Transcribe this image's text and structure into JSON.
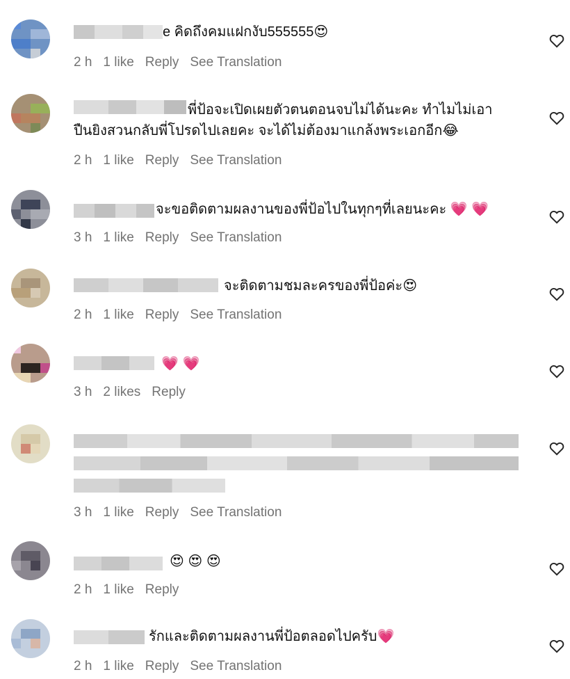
{
  "colors": {
    "meta": "#737373",
    "text": "#111111",
    "heart_red": "#e0245e"
  },
  "comments": [
    {
      "text": "e คิดถึงคมแฝกงับ555555",
      "emoji": "😍",
      "time": "2 h",
      "likes": "1 like",
      "reply": "Reply",
      "translate": "See Translation"
    },
    {
      "text": "พี่ป้อจะเปิดเผยตัวตนตอนจบไม่ได้นะคะ ทำไมไม่เอา",
      "text2": "ปืนยิงสวนกลับพี่โปรดไปเลยคะ จะได้ไม่ต้องมาแกล้งพระเอกอีก",
      "emoji": "😂",
      "time": "2 h",
      "likes": "1 like",
      "reply": "Reply",
      "translate": "See Translation"
    },
    {
      "text": "จะขอติดตามผลงานของพี่ป้อไปในทุกๆที่เลยนะคะ",
      "emoji": "💗 💗",
      "time": "3 h",
      "likes": "1 like",
      "reply": "Reply",
      "translate": "See Translation"
    },
    {
      "text": "จะติดตามชมละครของพี่ป้อค่ะ",
      "emoji": "😍",
      "time": "2 h",
      "likes": "1 like",
      "reply": "Reply",
      "translate": "See Translation"
    },
    {
      "text": "",
      "emoji": "💗 💗",
      "time": "3 h",
      "likes": "2 likes",
      "reply": "Reply"
    },
    {
      "text": "",
      "time": "3 h",
      "likes": "1 like",
      "reply": "Reply",
      "translate": "See Translation"
    },
    {
      "text": "",
      "emoji": "😍 😍 😍",
      "time": "2 h",
      "likes": "1 like",
      "reply": "Reply"
    },
    {
      "text": "รักและติดตามผลงานพี่ป้อตลอดไปครับ",
      "emoji": "💗",
      "time": "2 h",
      "likes": "1 like",
      "reply": "Reply",
      "translate": "See Translation"
    }
  ]
}
